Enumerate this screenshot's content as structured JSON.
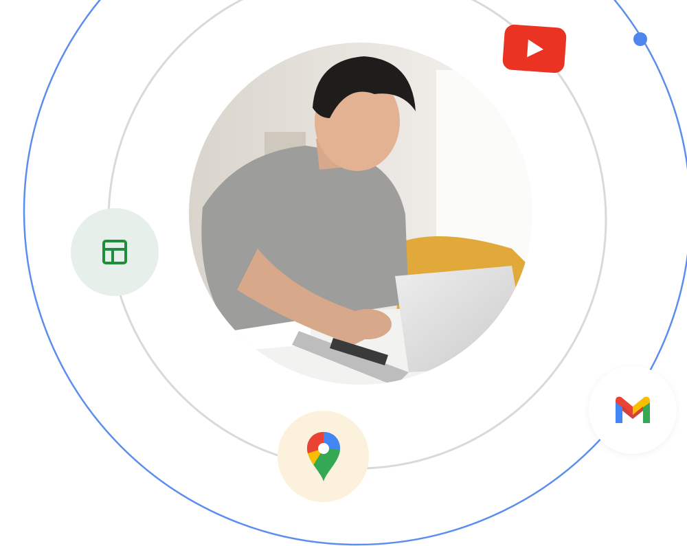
{
  "scene": {
    "photo_subject": "person-typing-on-laptop",
    "orbit_colors": {
      "outer": "#5b8def",
      "inner": "#d9d9d9"
    }
  },
  "app_icons": [
    {
      "name": "google-sheets-icon",
      "background": "#e6efe9",
      "color": "#1e8e3e"
    },
    {
      "name": "google-maps-icon",
      "background": "#fbf1dc"
    },
    {
      "name": "gmail-icon",
      "background": "#ffffff"
    },
    {
      "name": "youtube-icon",
      "background": "#ea3323"
    }
  ]
}
